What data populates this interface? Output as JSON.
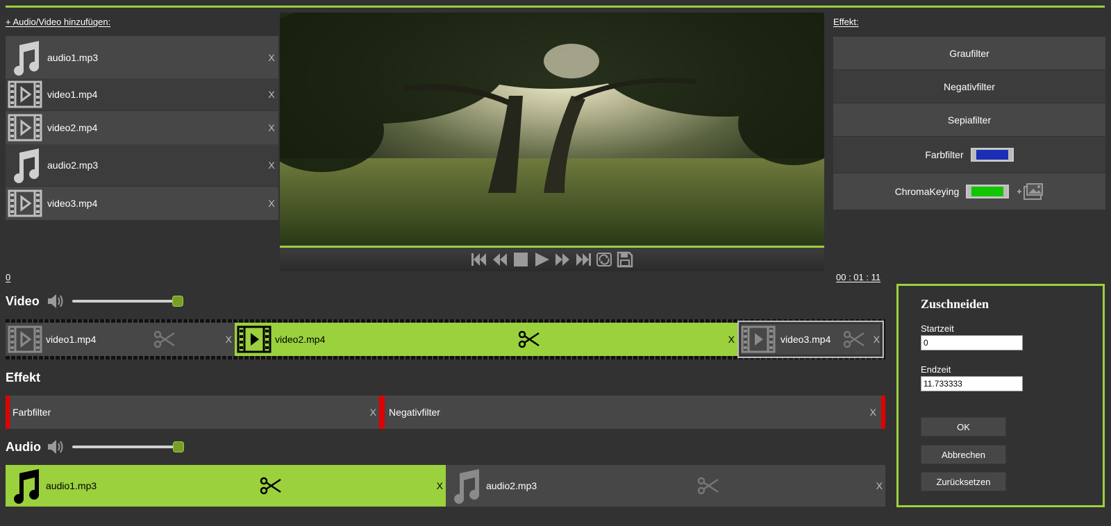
{
  "media": {
    "add_label": "+ Audio/Video hinzufügen:",
    "items": [
      {
        "name": "audio1.mp3",
        "type": "audio",
        "remove": "X"
      },
      {
        "name": "video1.mp4",
        "type": "video",
        "remove": "X"
      },
      {
        "name": "video2.mp4",
        "type": "video",
        "remove": "X"
      },
      {
        "name": "audio2.mp3",
        "type": "audio",
        "remove": "X"
      },
      {
        "name": "video3.mp4",
        "type": "video",
        "remove": "X"
      }
    ]
  },
  "effects": {
    "title": "Effekt:",
    "buttons": [
      "Graufilter",
      "Negativfilter",
      "Sepiafilter",
      "Farbfilter",
      "ChromaKeying"
    ],
    "farbfilter_color": "#1a2fb5",
    "chroma_color": "#13c400"
  },
  "timeline": {
    "start_time": "0",
    "end_time": "00 : 01 : 11",
    "video_label": "Video",
    "effect_label": "Effekt",
    "audio_label": "Audio",
    "video_volume": 1.0,
    "audio_volume": 1.0,
    "video_clips": [
      {
        "name": "video1.mp4",
        "remove": "X",
        "active": false
      },
      {
        "name": "video2.mp4",
        "remove": "X",
        "active": true
      },
      {
        "name": "video3.mp4",
        "remove": "X",
        "active": false
      }
    ],
    "effect_clips": [
      {
        "name": "Farbfilter",
        "remove": "X"
      },
      {
        "name": "Negativfilter",
        "remove": "X"
      }
    ],
    "audio_clips": [
      {
        "name": "audio1.mp3",
        "remove": "X",
        "active": true
      },
      {
        "name": "audio2.mp3",
        "remove": "X",
        "active": false
      }
    ]
  },
  "crop": {
    "title": "Zuschneiden",
    "start_label": "Startzeit",
    "start_value": "0",
    "end_label": "Endzeit",
    "end_value": "11.733333",
    "ok": "OK",
    "cancel": "Abbrechen",
    "reset": "Zurücksetzen"
  },
  "colors": {
    "accent": "#9bd13d",
    "effect_marker": "#e00000",
    "panel": "#474747",
    "background": "#323232"
  }
}
